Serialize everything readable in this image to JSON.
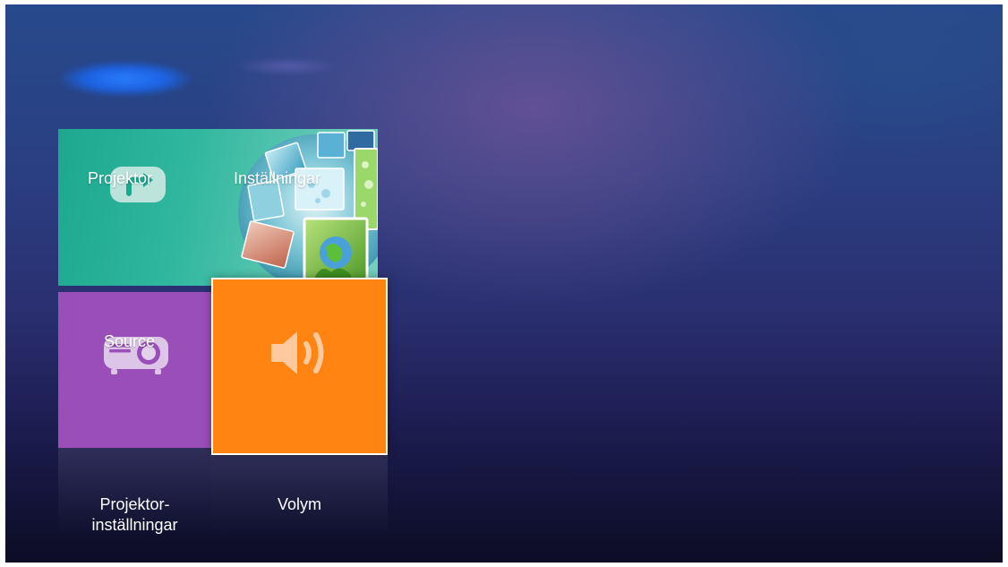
{
  "tiles": {
    "settings": {
      "label_left": "Projektor",
      "label_right": "Inställningar",
      "icon": "projector-return-icon",
      "art": "globe-photo-collage-icon",
      "color": "#1ca88f"
    },
    "source": {
      "label": "Source",
      "icon": "projector-icon",
      "color": "#9a4fb8"
    },
    "volume": {
      "icon": "speaker-icon",
      "color": "#ff8412",
      "selected": true
    }
  },
  "bottom_labels": {
    "settings_line1": "Projektor-",
    "settings_line2": "inställningar",
    "volume": "Volym"
  }
}
